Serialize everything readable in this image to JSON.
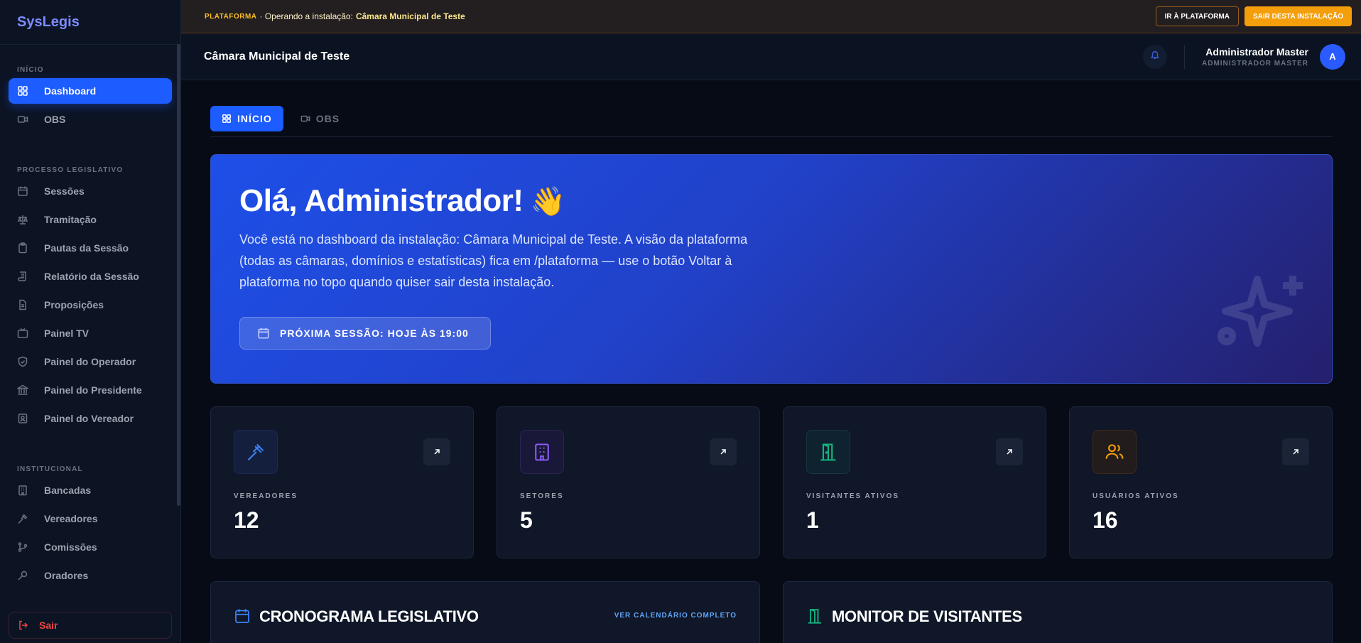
{
  "app": {
    "name": "SysLegis"
  },
  "sidebar": {
    "sections": [
      {
        "title": "INÍCIO",
        "items": [
          {
            "label": "Dashboard",
            "icon": "grid-icon",
            "active": true
          },
          {
            "label": "OBS",
            "icon": "video-icon"
          }
        ]
      },
      {
        "title": "PROCESSO LEGISLATIVO",
        "items": [
          {
            "label": "Sessões",
            "icon": "calendar-icon"
          },
          {
            "label": "Tramitação",
            "icon": "scale-icon"
          },
          {
            "label": "Pautas da Sessão",
            "icon": "clipboard-icon"
          },
          {
            "label": "Relatório da Sessão",
            "icon": "scroll-icon"
          },
          {
            "label": "Proposições",
            "icon": "document-icon"
          },
          {
            "label": "Painel TV",
            "icon": "tv-icon"
          },
          {
            "label": "Painel do Operador",
            "icon": "shield-icon"
          },
          {
            "label": "Painel do Presidente",
            "icon": "landmark-icon"
          },
          {
            "label": "Painel do Vereador",
            "icon": "badge-icon"
          }
        ]
      },
      {
        "title": "INSTITUCIONAL",
        "items": [
          {
            "label": "Bancadas",
            "icon": "building-icon"
          },
          {
            "label": "Vereadores",
            "icon": "gavel-icon"
          },
          {
            "label": "Comissões",
            "icon": "branch-icon"
          },
          {
            "label": "Oradores",
            "icon": "mic-icon"
          }
        ]
      }
    ],
    "logout": "Sair"
  },
  "banner": {
    "platform_tag": "PLATAFORMA",
    "text": "· Operando a instalação:",
    "installation": "Câmara Municipal de Teste",
    "go_platform": "IR À PLATAFORMA",
    "leave": "SAIR DESTA INSTALAÇÃO"
  },
  "header": {
    "title": "Câmara Municipal de Teste",
    "user_name": "Administrador Master",
    "user_role": "ADMINISTRADOR MASTER",
    "avatar_initial": "A"
  },
  "tabs": [
    {
      "label": "INÍCIO",
      "active": true
    },
    {
      "label": "OBS",
      "active": false
    }
  ],
  "hero": {
    "greeting": "Olá, Administrador!",
    "emoji": "👋",
    "description": "Você está no dashboard da instalação: Câmara Municipal de Teste. A visão da plataforma (todas as câmaras, domínios e estatísticas) fica em /plataforma — use o botão Voltar à plataforma no topo quando quiser sair desta instalação.",
    "next_session": "PRÓXIMA SESSÃO: HOJE ÀS 19:00"
  },
  "stats": [
    {
      "label": "VEREADORES",
      "value": "12",
      "icon": "gavel-icon",
      "color": "#3b82f6"
    },
    {
      "label": "SETORES",
      "value": "5",
      "icon": "building-icon",
      "color": "#8b5cf6"
    },
    {
      "label": "VISITANTES ATIVOS",
      "value": "1",
      "icon": "door-icon",
      "color": "#10b981"
    },
    {
      "label": "USUÁRIOS ATIVOS",
      "value": "16",
      "icon": "users-icon",
      "color": "#f59e0b"
    }
  ],
  "panels": {
    "schedule_title": "CRONOGRAMA LEGISLATIVO",
    "schedule_link": "VER CALENDÁRIO COMPLETO",
    "visitors_title": "MONITOR DE VISITANTES"
  }
}
